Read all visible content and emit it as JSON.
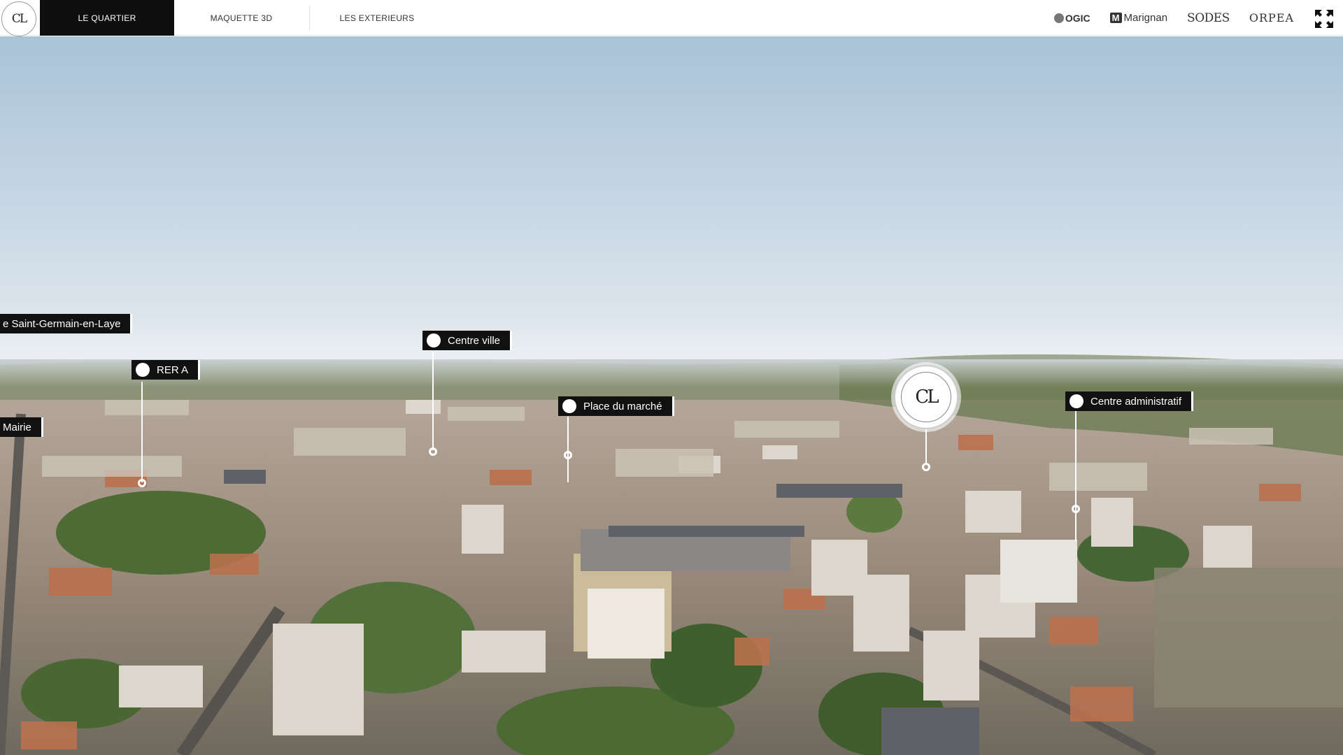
{
  "brand": {
    "monogram": "CL"
  },
  "nav": {
    "tabs": [
      {
        "label": "LE QUARTIER",
        "active": true
      },
      {
        "label": "MAQUETTE 3D",
        "active": false
      },
      {
        "label": "LES EXTERIEURS",
        "active": false
      }
    ]
  },
  "partners": {
    "ogic": "OGIC",
    "marignan_m": "M",
    "marignan": "Marignan",
    "sodes": "SODES",
    "orpea": "ORPEA"
  },
  "markers": {
    "chateau": "e Saint-Germain-en-Laye",
    "rer": "RER A",
    "centre_ville": "Centre ville",
    "mairie": "Mairie",
    "place_marche": "Place du marché",
    "centre_admin": "Centre administratif"
  },
  "project_badge": {
    "monogram": "CL"
  },
  "colors": {
    "nav_active_bg": "#0f0f0f",
    "marker_bg": "#111111",
    "marker_text": "#ffffff"
  }
}
